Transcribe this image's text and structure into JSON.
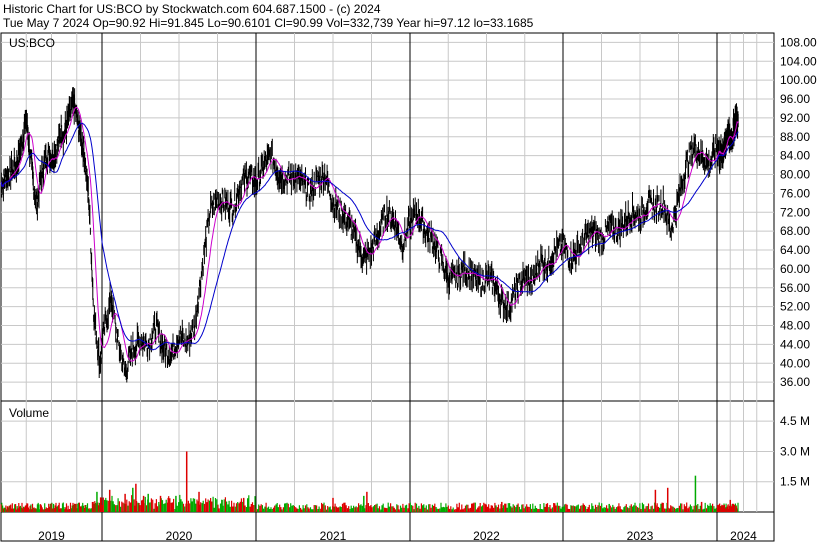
{
  "header": {
    "line1": "Historic Chart for US:BCO by Stockwatch.com 604.687.1500 - (c) 2024",
    "line2": "Tue May  7 2024  Op=90.92  Hi=91.845  Lo=90.6101  Cl=90.99  Vol=332,739  Year hi=97.12  lo=33.1685"
  },
  "colors": {
    "price": "#000000",
    "ma_short": "#cc00cc",
    "ma_long": "#0000cc",
    "vol_up": "#00aa00",
    "vol_down": "#dd0000",
    "grid": "#c8c8c8"
  },
  "chart_data": [
    {
      "type": "line",
      "title": "US:BCO",
      "ylim": [
        32,
        110
      ],
      "y_ticks": [
        "108.00",
        "104.00",
        "100.00",
        "96.00",
        "92.00",
        "88.00",
        "84.00",
        "80.00",
        "76.00",
        "72.00",
        "68.00",
        "64.00",
        "60.00",
        "56.00",
        "52.00",
        "48.00",
        "44.00",
        "40.00",
        "36.00"
      ],
      "x_ticks": [
        "2019",
        "2020",
        "2021",
        "2022",
        "2023",
        "2024"
      ],
      "series": [
        {
          "values_note": "",
          "t": [
            0,
            0.08,
            0.15,
            0.2,
            0.25,
            0.3,
            0.35,
            0.4,
            0.45,
            0.5,
            0.55,
            0.6,
            0.62,
            0.67,
            0.72,
            0.77,
            0.82,
            0.87,
            0.92,
            0.98,
            1.02,
            1.06,
            1.1,
            1.15,
            1.2,
            1.25,
            1.3,
            1.35,
            1.4,
            1.45,
            1.5,
            1.55,
            1.6,
            1.65,
            1.7,
            1.75,
            1.8,
            1.85,
            1.9,
            1.95,
            2.0,
            2.05,
            2.1,
            2.15,
            2.2,
            2.25,
            2.3,
            2.35,
            2.4,
            2.45,
            2.5,
            2.55,
            2.6,
            2.65,
            2.7,
            2.75,
            2.8,
            2.85,
            2.9,
            2.95,
            3.0,
            3.05,
            3.1,
            3.15,
            3.2,
            3.25,
            3.3,
            3.35,
            3.4,
            3.45,
            3.5,
            3.55,
            3.6,
            3.65,
            3.7,
            3.75,
            3.8,
            3.85,
            3.9,
            3.95,
            4.0,
            4.05,
            4.1,
            4.15,
            4.2,
            4.25,
            4.3,
            4.35,
            4.4,
            4.45,
            4.5,
            4.55,
            4.6,
            4.65,
            4.7,
            4.75,
            4.8,
            4.85,
            4.9,
            4.95,
            5.0,
            5.05,
            5.1,
            5.15,
            5.2,
            5.25,
            5.3,
            5.35,
            5.4
          ],
          "values": [
            78,
            80,
            82,
            86,
            92,
            82,
            73,
            80,
            84,
            84,
            85,
            90,
            88,
            92,
            95,
            90,
            85,
            75,
            50,
            40,
            48,
            54,
            45,
            38,
            43,
            45,
            44,
            48,
            43,
            42,
            46,
            44,
            48,
            60,
            72,
            75,
            74,
            73,
            78,
            80,
            78,
            82,
            84,
            80,
            79,
            80,
            78,
            76,
            79,
            80,
            74,
            72,
            70,
            66,
            62,
            64,
            68,
            72,
            70,
            65,
            70,
            72,
            68,
            66,
            62,
            58,
            58,
            60,
            59,
            57,
            58,
            57,
            53,
            52,
            56,
            58,
            57,
            62,
            61,
            64,
            65,
            62,
            64,
            67,
            68,
            66,
            69,
            68,
            70,
            72,
            71,
            74,
            73,
            74,
            68,
            75,
            82,
            86,
            84,
            82,
            86,
            84,
            85,
            86,
            89,
            87,
            89,
            92,
            91
          ],
          "name": ""
        }
      ]
    },
    {
      "type": "bar",
      "title": "Volume",
      "ylim": [
        0,
        5.5
      ],
      "y_ticks": [
        "4.5 M",
        "3.0 M",
        "1.5 M"
      ],
      "spikes": [
        {
          "t": 0.95,
          "v": 1.0
        },
        {
          "t": 1.05,
          "v": 1.1
        },
        {
          "t": 1.15,
          "v": 0.9
        },
        {
          "t": 1.2,
          "v": 1.2
        },
        {
          "t": 1.22,
          "v": 1.4
        },
        {
          "t": 1.27,
          "v": 0.8
        },
        {
          "t": 1.3,
          "v": 0.9
        },
        {
          "t": 1.38,
          "v": 0.8
        },
        {
          "t": 1.43,
          "v": 0.7
        },
        {
          "t": 1.48,
          "v": 0.8
        },
        {
          "t": 1.55,
          "v": 3.0
        },
        {
          "t": 1.63,
          "v": 1.0
        },
        {
          "t": 1.78,
          "v": 0.6
        },
        {
          "t": 1.92,
          "v": 0.7
        },
        {
          "t": 2.5,
          "v": 0.7
        },
        {
          "t": 2.7,
          "v": 0.8
        },
        {
          "t": 2.72,
          "v": 1.0
        },
        {
          "t": 3.6,
          "v": 0.5
        },
        {
          "t": 4.3,
          "v": 0.4
        },
        {
          "t": 4.6,
          "v": 1.1
        },
        {
          "t": 4.68,
          "v": 1.2
        },
        {
          "t": 4.86,
          "v": 1.8
        },
        {
          "t": 4.9,
          "v": 0.5
        },
        {
          "t": 5.25,
          "v": 0.6
        }
      ]
    }
  ]
}
